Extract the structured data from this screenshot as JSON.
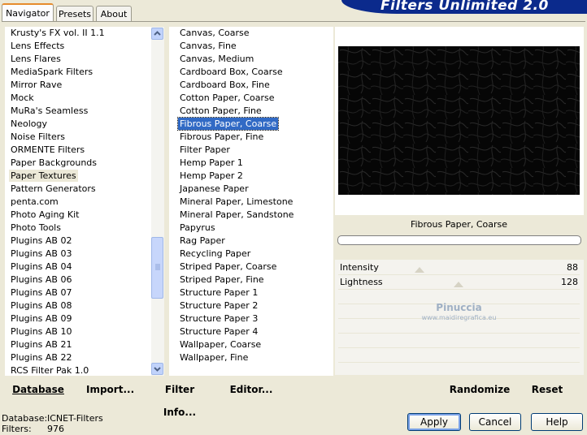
{
  "tabs": [
    {
      "label": "Navigator",
      "active": true
    },
    {
      "label": "Presets",
      "active": false
    },
    {
      "label": "About",
      "active": false
    }
  ],
  "banner_title": "Filters Unlimited 2.0",
  "categories": [
    "Krusty's FX vol. II 1.1",
    "Lens Effects",
    "Lens Flares",
    "MediaSpark Filters",
    "Mirror Rave",
    "Mock",
    "MuRa's Seamless",
    "Neology",
    "Noise Filters",
    "ORMENTE Filters",
    "Paper Backgrounds",
    "Paper Textures",
    "Pattern Generators",
    "penta.com",
    "Photo Aging Kit",
    "Photo Tools",
    "Plugins AB 02",
    "Plugins AB 03",
    "Plugins AB 04",
    "Plugins AB 06",
    "Plugins AB 07",
    "Plugins AB 08",
    "Plugins AB 09",
    "Plugins AB 10",
    "Plugins AB 21",
    "Plugins AB 22",
    "RCS Filter Pak 1.0"
  ],
  "selected_category": "Paper Textures",
  "filters": [
    "Canvas, Coarse",
    "Canvas, Fine",
    "Canvas, Medium",
    "Cardboard Box, Coarse",
    "Cardboard Box, Fine",
    "Cotton Paper, Coarse",
    "Cotton Paper, Fine",
    "Fibrous Paper, Coarse",
    "Fibrous Paper, Fine",
    "Filter Paper",
    "Hemp Paper 1",
    "Hemp Paper 2",
    "Japanese Paper",
    "Mineral Paper, Limestone",
    "Mineral Paper, Sandstone",
    "Papyrus",
    "Rag Paper",
    "Recycling Paper",
    "Striped Paper, Coarse",
    "Striped Paper, Fine",
    "Structure Paper 1",
    "Structure Paper 2",
    "Structure Paper 3",
    "Structure Paper 4",
    "Wallpaper, Coarse",
    "Wallpaper, Fine"
  ],
  "selected_filter": "Fibrous Paper, Coarse",
  "toolbar": {
    "database": "Database",
    "import": "Import...",
    "filter_info": "Filter Info...",
    "editor": "Editor...",
    "randomize": "Randomize",
    "reset": "Reset"
  },
  "preview_filter_name": "Fibrous Paper, Coarse",
  "watermark": {
    "line1": "Pinuccia",
    "line2": "www.maidiregrafica.eu"
  },
  "params": [
    {
      "label": "Intensity",
      "value": "88"
    },
    {
      "label": "Lightness",
      "value": "128"
    }
  ],
  "status": {
    "database_label": "Database:",
    "database_value": "ICNET-Filters",
    "filters_label": "Filters:",
    "filters_value": "976"
  },
  "buttons": {
    "apply": "Apply",
    "cancel": "Cancel",
    "help": "Help"
  },
  "colors": {
    "banner": "#0b2a8c",
    "selection": "#316ac5",
    "dialog_bg": "#ece9d8"
  }
}
